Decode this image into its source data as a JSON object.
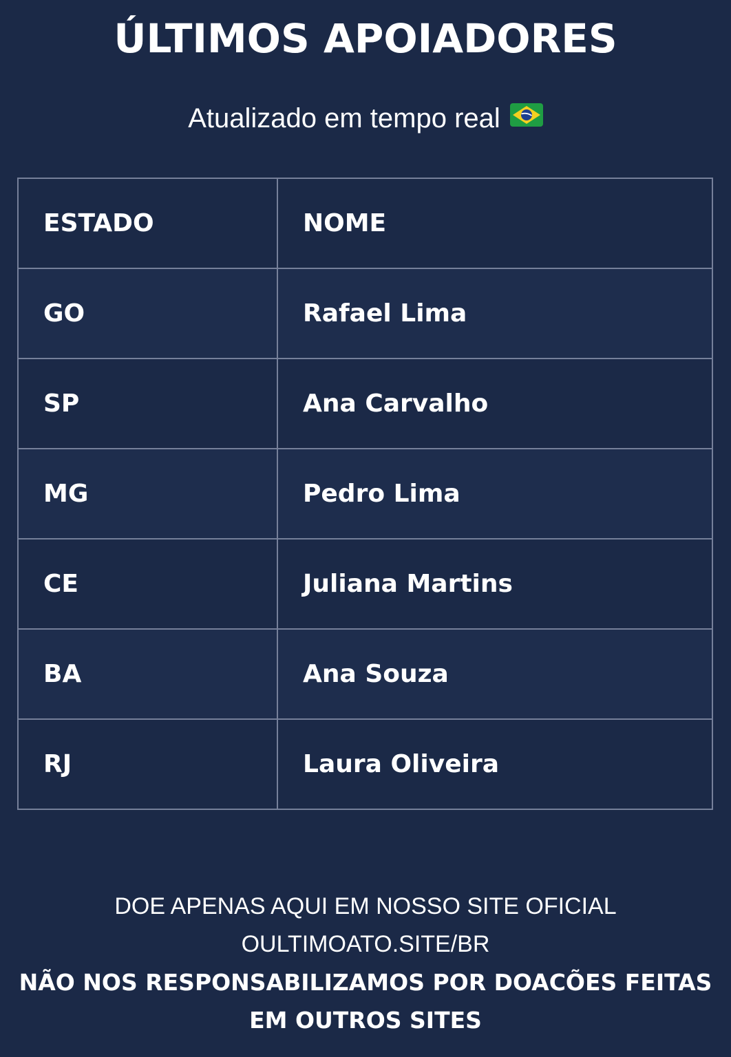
{
  "header": {
    "title": "ÚLTIMOS APOIADORES",
    "subtitle": "Atualizado em tempo real",
    "flag_icon": "brazil-flag-icon"
  },
  "table": {
    "headers": [
      "ESTADO",
      "NOME"
    ],
    "rows": [
      {
        "estado": "GO",
        "nome": "Rafael Lima"
      },
      {
        "estado": "SP",
        "nome": "Ana Carvalho"
      },
      {
        "estado": "MG",
        "nome": "Pedro Lima"
      },
      {
        "estado": "CE",
        "nome": "Juliana Martins"
      },
      {
        "estado": "BA",
        "nome": "Ana Souza"
      },
      {
        "estado": "RJ",
        "nome": "Laura Oliveira"
      }
    ]
  },
  "footer": {
    "line1": "DOE APENAS AQUI EM NOSSO SITE OFICIAL",
    "line2": "OULTIMOATO.SITE/BR",
    "disclaimer1": "NÃO NOS RESPONSABILIZAMOS POR DOACÕES FEITAS",
    "disclaimer2": "EM OUTROS SITES"
  },
  "colors": {
    "background": "#1b2947",
    "text": "#ffffff",
    "border": "#76809a"
  }
}
